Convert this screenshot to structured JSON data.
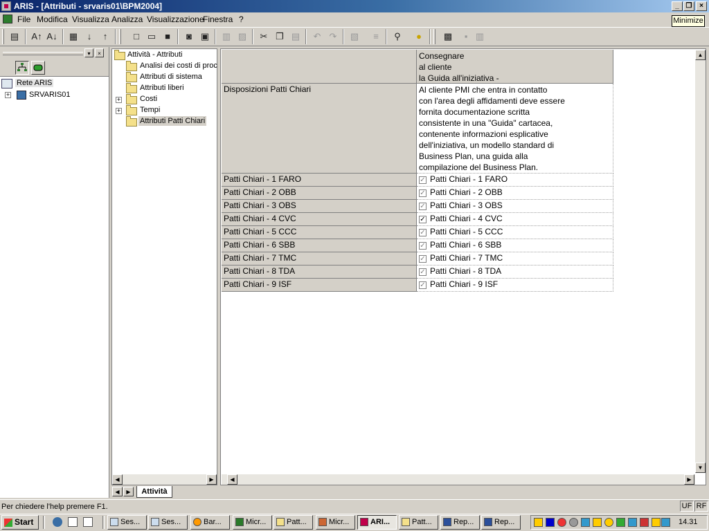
{
  "window": {
    "title": "ARIS - [Attributi - srvaris01\\BPM2004]",
    "tooltip": "Minimize"
  },
  "menu": [
    "File",
    "Modifica",
    "Visualizza",
    "Analizza",
    "Visualizzazione",
    "Finestra",
    "?"
  ],
  "left_tree": {
    "root": "Rete ARIS",
    "child": "SRVARIS01"
  },
  "folder_tree": {
    "root": "Attività - Attributi",
    "items": [
      "Analisi dei costi di proce",
      "Attributi di sistema",
      "Attributi liberi",
      "Costi",
      "Tempi",
      "Attributi Patti Chiari"
    ],
    "selected": "Attributi Patti Chiari"
  },
  "grid": {
    "header_lines": [
      "Consegnare",
      "al cliente",
      "la Guida all'iniziativa -"
    ],
    "disposition_label": "Disposizioni Patti Chiari",
    "disposition_text": [
      "Al cliente PMI che entra in contatto",
      "con l'area degli affidamenti deve essere",
      "fornita documentazione scritta",
      "consistente in una \"Guida\" cartacea,",
      "contenente informazioni esplicative",
      "dell'iniziativa, un modello standard di",
      "Business Plan, una guida alla",
      "compilazione del Business Plan."
    ],
    "rows": [
      {
        "label": "Patti Chiari - 1 FARO",
        "value": "Patti Chiari - 1 FARO",
        "checked": "grey"
      },
      {
        "label": "Patti Chiari - 2 OBB",
        "value": "Patti Chiari - 2 OBB",
        "checked": "grey"
      },
      {
        "label": "Patti Chiari - 3 OBS",
        "value": "Patti Chiari - 3 OBS",
        "checked": "grey"
      },
      {
        "label": "Patti Chiari - 4 CVC",
        "value": "Patti Chiari - 4 CVC",
        "checked": "black"
      },
      {
        "label": "Patti Chiari - 5 CCC",
        "value": "Patti Chiari - 5 CCC",
        "checked": "grey"
      },
      {
        "label": "Patti Chiari - 6 SBB",
        "value": "Patti Chiari - 6 SBB",
        "checked": "grey"
      },
      {
        "label": "Patti Chiari - 7 TMC",
        "value": "Patti Chiari - 7 TMC",
        "checked": "grey"
      },
      {
        "label": "Patti Chiari - 8 TDA",
        "value": "Patti Chiari - 8 TDA",
        "checked": "grey"
      },
      {
        "label": "Patti Chiari - 9 ISF",
        "value": "Patti Chiari - 9 ISF",
        "checked": "grey"
      }
    ]
  },
  "sheet_tab": "Attività",
  "status": {
    "text": "Per chiedere l'help premere F1.",
    "indicators": [
      "UF",
      "RF"
    ]
  },
  "taskbar": {
    "start": "Start",
    "tasks": [
      "Ses...",
      "Ses...",
      "Bar...",
      "Micr...",
      "Patt...",
      "Micr...",
      "ARI...",
      "Patt...",
      "Rep...",
      "Rep..."
    ],
    "active_task": "ARI...",
    "clock": "14.31"
  },
  "colors": {
    "titlebar_start": "#0a246a",
    "titlebar_end": "#a6caf0",
    "chrome": "#d4d0c8",
    "check_grey": "#808080",
    "check_black": "#000000"
  }
}
